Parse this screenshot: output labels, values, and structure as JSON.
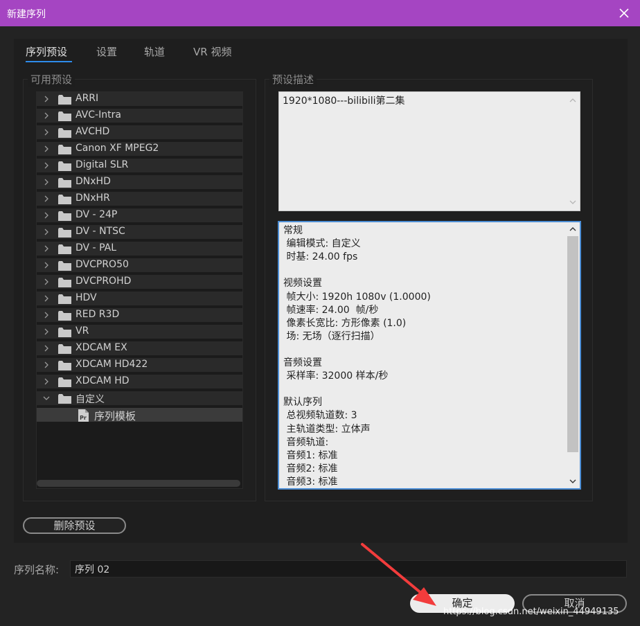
{
  "window": {
    "title": "新建序列"
  },
  "tabs": [
    {
      "label": "序列预设"
    },
    {
      "label": "设置"
    },
    {
      "label": "轨道"
    },
    {
      "label": "VR 视频"
    }
  ],
  "presets": {
    "label": "可用预设",
    "folders": [
      "ARRI",
      "AVC-Intra",
      "AVCHD",
      "Canon XF MPEG2",
      "Digital SLR",
      "DNxHD",
      "DNxHR",
      "DV - 24P",
      "DV - NTSC",
      "DV - PAL",
      "DVCPRO50",
      "DVCPROHD",
      "HDV",
      "RED R3D",
      "VR",
      "XDCAM EX",
      "XDCAM HD422",
      "XDCAM HD"
    ],
    "custom_folder": "自定义",
    "custom_item": "序列模板"
  },
  "description": {
    "label": "预设描述",
    "text": "1920*1080---bilibili第二集",
    "info_lines": [
      "常规",
      " 编辑模式: 自定义",
      " 时基: 24.00 fps",
      "",
      "视频设置",
      " 帧大小: 1920h 1080v (1.0000)",
      " 帧速率: 24.00  帧/秒",
      " 像素长宽比: 方形像素 (1.0)",
      " 场: 无场（逐行扫描）",
      "",
      "音频设置",
      " 采样率: 32000 样本/秒",
      "",
      "默认序列",
      " 总视频轨道数: 3",
      " 主轨道类型: 立体声",
      " 音频轨道:",
      " 音频1: 标准",
      " 音频2: 标准",
      " 音频3: 标准"
    ]
  },
  "buttons": {
    "delete_preset": "删除预设",
    "ok": "确定",
    "cancel": "取消"
  },
  "sequence_name": {
    "label": "序列名称:",
    "value": "序列 02"
  },
  "watermark": "https://blog.csdn.net/weixin_44949135",
  "colors": {
    "titlebar": "#a545c2",
    "tab_underline": "#2d8ceb",
    "focus_border": "#4e8fd6",
    "annotation_arrow": "#f23c3c"
  }
}
